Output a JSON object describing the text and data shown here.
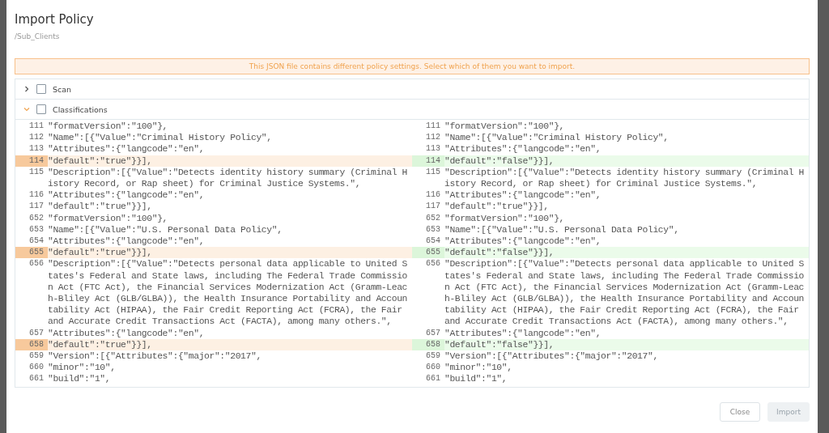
{
  "dialog": {
    "title": "Import Policy",
    "subtitle": "/Sub_Clients"
  },
  "banner": "This JSON file contains different policy settings. Select which of them you want to import.",
  "sections": [
    {
      "label": "Scan",
      "expanded": false,
      "checked": false
    },
    {
      "label": "Classifications",
      "expanded": true,
      "checked": false
    }
  ],
  "diff": {
    "panes": [
      {
        "kind": "current",
        "lines": [
          {
            "number": "111",
            "text": "\"formatVersion\":\"100\"},",
            "changed": false
          },
          {
            "number": "112",
            "text": "\"Name\":[{\"Value\":\"Criminal History Policy\",",
            "changed": false
          },
          {
            "number": "113",
            "text": "\"Attributes\":{\"langcode\":\"en\",",
            "changed": false
          },
          {
            "number": "114",
            "text": "\"default\":\"true\"}}],",
            "changed": true
          },
          {
            "number": "115",
            "text": "\"Description\":[{\"Value\":\"Detects identity history summary (Criminal History Record, or Rap sheet) for Criminal Justice Systems.\",",
            "changed": false
          },
          {
            "number": "116",
            "text": "\"Attributes\":{\"langcode\":\"en\",",
            "changed": false
          },
          {
            "number": "117",
            "text": "\"default\":\"true\"}}],",
            "changed": false
          },
          {
            "number": "652",
            "text": "\"formatVersion\":\"100\"},",
            "changed": false
          },
          {
            "number": "653",
            "text": "\"Name\":[{\"Value\":\"U.S. Personal Data Policy\",",
            "changed": false
          },
          {
            "number": "654",
            "text": "\"Attributes\":{\"langcode\":\"en\",",
            "changed": false
          },
          {
            "number": "655",
            "text": "\"default\":\"true\"}}],",
            "changed": true
          },
          {
            "number": "656",
            "text": "\"Description\":[{\"Value\":\"Detects personal data applicable to United States's Federal and State laws, including The Federal Trade Commission Act (FTC Act), the Financial Services Modernization Act (Gramm-Leach-Bliley Act (GLB/GLBA)), the Health Insurance Portability and Accountability Act (HIPAA), the Fair Credit Reporting Act (FCRA), the Fair and Accurate Credit Transactions Act (FACTA), among many others.\",",
            "changed": false
          },
          {
            "number": "657",
            "text": "\"Attributes\":{\"langcode\":\"en\",",
            "changed": false
          },
          {
            "number": "658",
            "text": "\"default\":\"true\"}}],",
            "changed": true
          },
          {
            "number": "659",
            "text": "\"Version\":[{\"Attributes\":{\"major\":\"2017\",",
            "changed": false
          },
          {
            "number": "660",
            "text": "\"minor\":\"10\",",
            "changed": false
          },
          {
            "number": "661",
            "text": "\"build\":\"1\",",
            "changed": false
          }
        ]
      },
      {
        "kind": "incoming",
        "lines": [
          {
            "number": "111",
            "text": "\"formatVersion\":\"100\"},",
            "changed": false
          },
          {
            "number": "112",
            "text": "\"Name\":[{\"Value\":\"Criminal History Policy\",",
            "changed": false
          },
          {
            "number": "113",
            "text": "\"Attributes\":{\"langcode\":\"en\",",
            "changed": false
          },
          {
            "number": "114",
            "text": "\"default\":\"false\"}}],",
            "changed": true
          },
          {
            "number": "115",
            "text": "\"Description\":[{\"Value\":\"Detects identity history summary (Criminal History Record, or Rap sheet) for Criminal Justice Systems.\",",
            "changed": false
          },
          {
            "number": "116",
            "text": "\"Attributes\":{\"langcode\":\"en\",",
            "changed": false
          },
          {
            "number": "117",
            "text": "\"default\":\"true\"}}],",
            "changed": false
          },
          {
            "number": "652",
            "text": "\"formatVersion\":\"100\"},",
            "changed": false
          },
          {
            "number": "653",
            "text": "\"Name\":[{\"Value\":\"U.S. Personal Data Policy\",",
            "changed": false
          },
          {
            "number": "654",
            "text": "\"Attributes\":{\"langcode\":\"en\",",
            "changed": false
          },
          {
            "number": "655",
            "text": "\"default\":\"false\"}}],",
            "changed": true
          },
          {
            "number": "656",
            "text": "\"Description\":[{\"Value\":\"Detects personal data applicable to United States's Federal and State laws, including The Federal Trade Commission Act (FTC Act), the Financial Services Modernization Act (Gramm-Leach-Bliley Act (GLB/GLBA)), the Health Insurance Portability and Accountability Act (HIPAA), the Fair Credit Reporting Act (FCRA), the Fair and Accurate Credit Transactions Act (FACTA), among many others.\",",
            "changed": false
          },
          {
            "number": "657",
            "text": "\"Attributes\":{\"langcode\":\"en\",",
            "changed": false
          },
          {
            "number": "658",
            "text": "\"default\":\"false\"}}],",
            "changed": true
          },
          {
            "number": "659",
            "text": "\"Version\":[{\"Attributes\":{\"major\":\"2017\",",
            "changed": false
          },
          {
            "number": "660",
            "text": "\"minor\":\"10\",",
            "changed": false
          },
          {
            "number": "661",
            "text": "\"build\":\"1\",",
            "changed": false
          }
        ]
      }
    ]
  },
  "buttons": [
    {
      "label": "Close",
      "disabled": false
    },
    {
      "label": "Import",
      "disabled": true
    }
  ]
}
